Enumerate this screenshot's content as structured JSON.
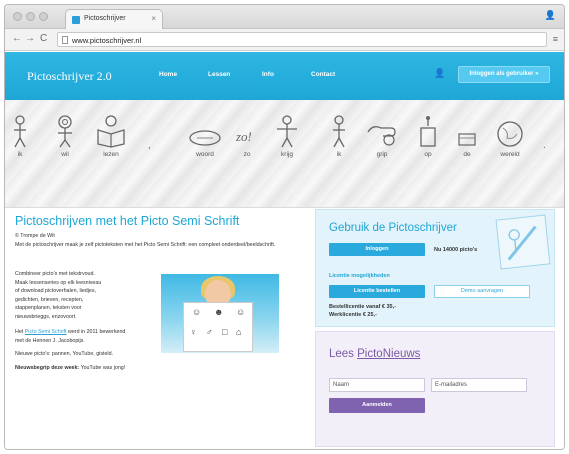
{
  "browser": {
    "tab_title": "Pictoschrijver",
    "tab_close": "×",
    "user_icon": "👤",
    "back": "←",
    "forward": "→",
    "reload": "C",
    "url": "www.pictoschrijver.nl",
    "menu_icon": "≡"
  },
  "site_nav": {
    "logo": "Pictoschrijver 2.0",
    "links": [
      "Home",
      "Lessen",
      "Info",
      "Contact"
    ],
    "user_glyph": "👤",
    "login_button": "Inloggen als gebruiker »"
  },
  "banner": {
    "pictos": [
      {
        "word": "ik",
        "icon": "person-icon"
      },
      {
        "word": "wil",
        "icon": "thinking-person-icon"
      },
      {
        "word": "lezen",
        "icon": "reading-icon"
      },
      {
        "word": "woord",
        "icon": "word-bubble-icon"
      },
      {
        "word": "zo",
        "icon": "zo-icon"
      },
      {
        "word": "krijg",
        "icon": "receive-icon"
      },
      {
        "word": "ik",
        "icon": "person-icon"
      },
      {
        "word": "grip",
        "icon": "grip-hand-icon"
      },
      {
        "word": "op",
        "icon": "on-top-icon"
      },
      {
        "word": "de",
        "icon": "de-icon"
      },
      {
        "word": "wereld",
        "icon": "globe-icon"
      }
    ],
    "punctuation_1": ",",
    "punctuation_2": "."
  },
  "main": {
    "heading": "Pictoschrijven met het Picto Semi Schrift",
    "copyright": "© Trompe de Wit",
    "intro": "Met de pictoschrijver maak je zelf pictoteksten met het Picto Semi Schrift: een compleet onderdeel/beeldschrift.",
    "list_lines": [
      "Combineer picto's met tekstrvoud.",
      "Maak lessenseries op elk leesniveau",
      "of download pictoverhalen, liedjes,",
      "gedichten, brieven, recepten,",
      "stappenplanen, teksten voor",
      "nieuwsbrieggs, enzovoort."
    ],
    "dev_pre": "Het",
    "dev_link": "Picto Semi Schrift",
    "dev_post": "werd in 2011 bewerkend",
    "dev_line2": "met de Hennen J. Jacobopijs.",
    "news_line": "Nieuwe picto's: pannen, YouTube, gisteld.",
    "word_label": "Nieuwsbegrip deze week:",
    "word_value": "YouTube was jong!"
  },
  "panel_blue": {
    "title": "Gebruik de Pictoschrijver",
    "login_button": "Inloggen",
    "picto_count": "Nu 14000 picto's",
    "licence_heading": "Licentie mogelijkheden",
    "licence_button": "Licentie bestellen",
    "demo_button": "Demo aanvragen",
    "price_line1": "Bestellicentie vanaf € 35,-",
    "price_line2": "Werklicentie € 25,-"
  },
  "panel_purple": {
    "title_prefix": "Lees ",
    "title_link": "PictoNieuws",
    "name_placeholder": "Naam",
    "email_placeholder": "E-mailadres",
    "subscribe_button": "Aanmelden"
  },
  "colors": {
    "accent_blue": "#1ea6d6",
    "accent_purple": "#7f62b0"
  }
}
